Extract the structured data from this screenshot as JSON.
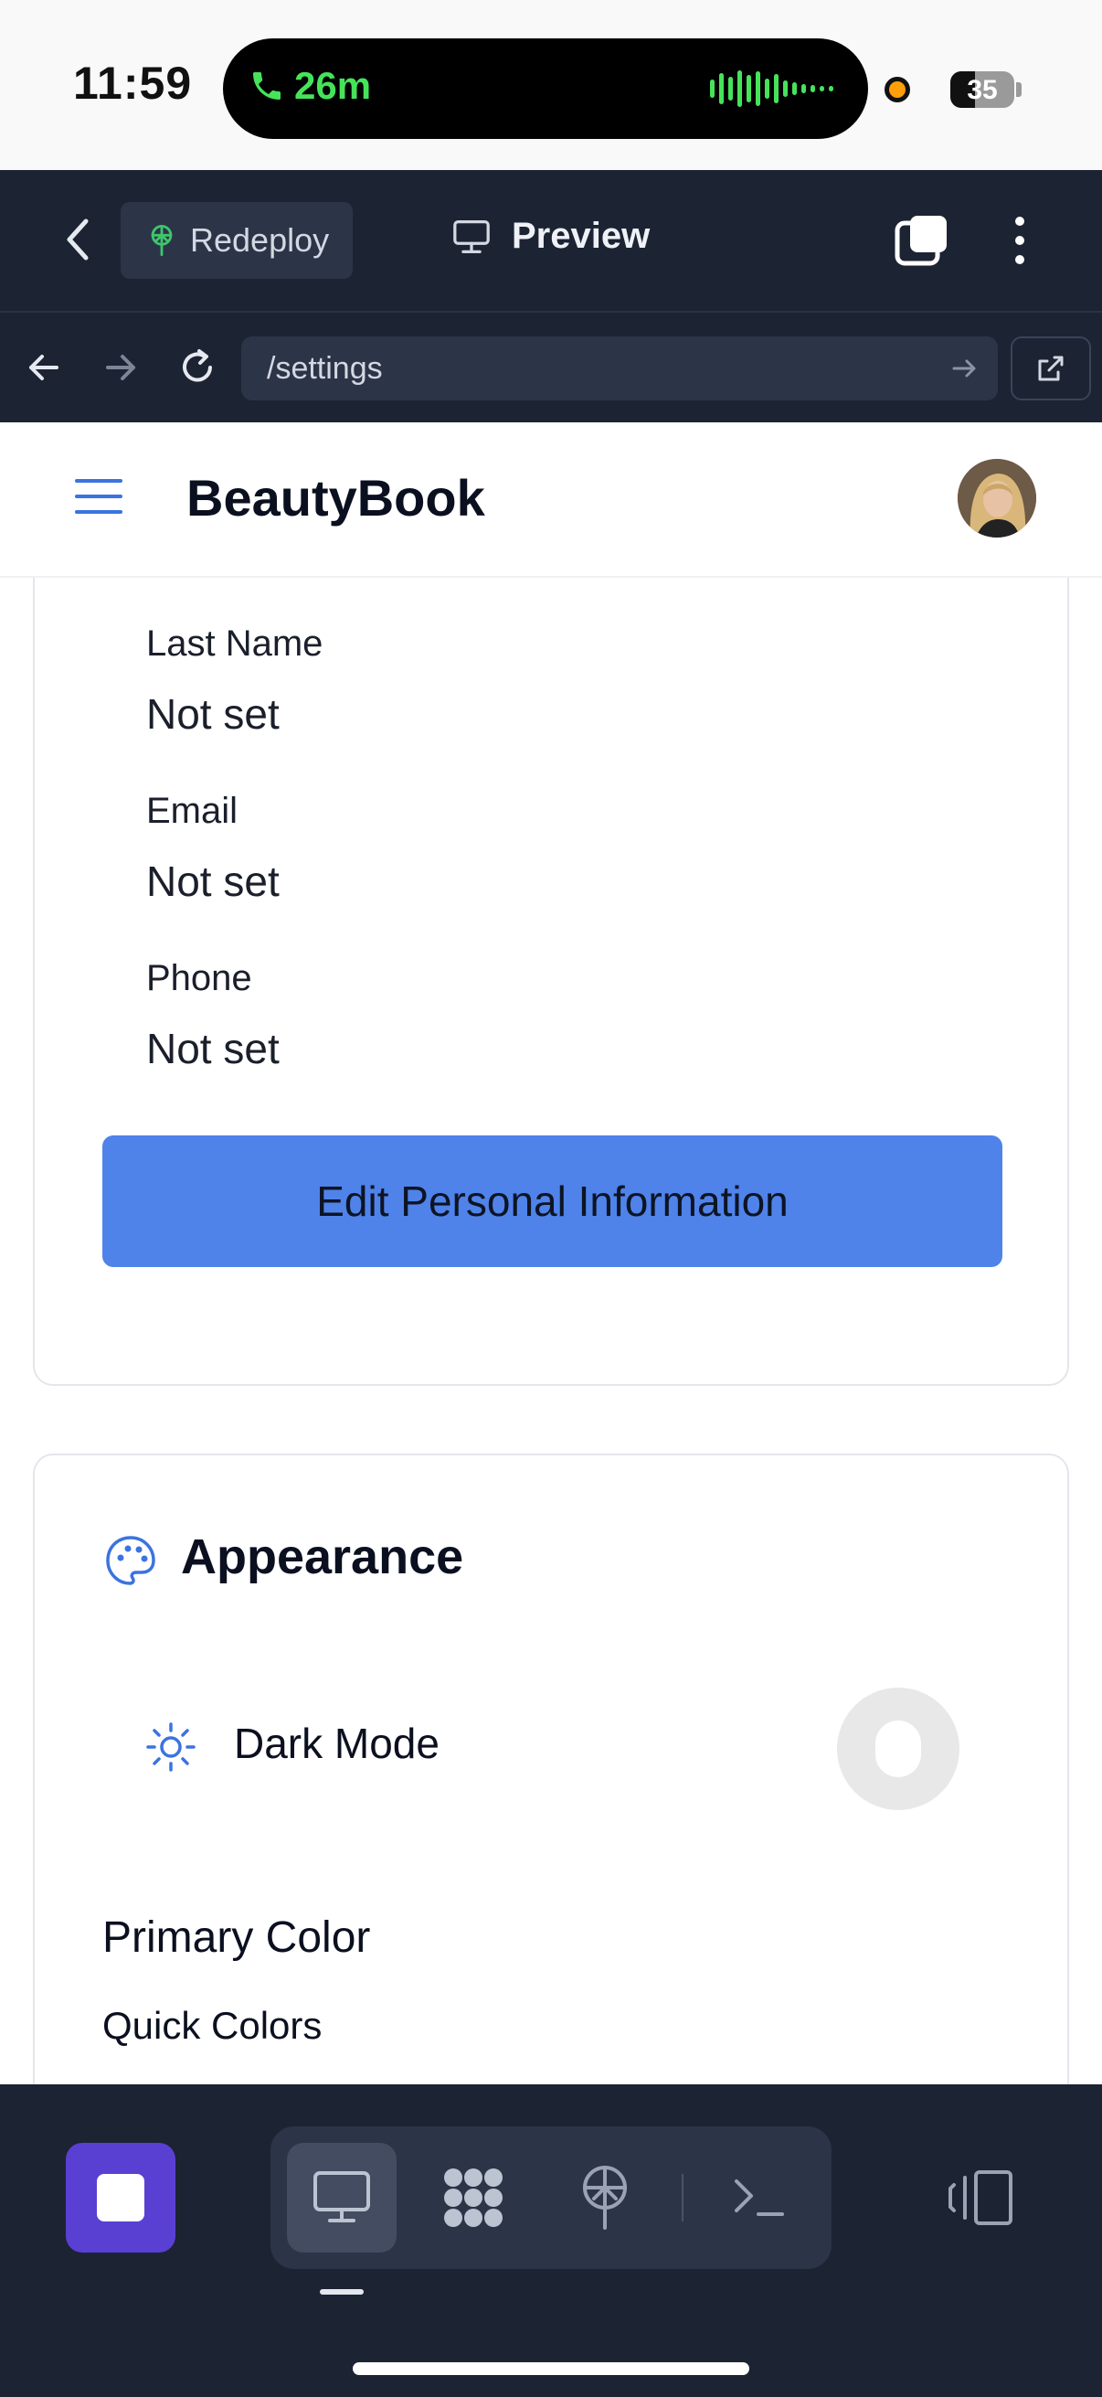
{
  "status_bar": {
    "time": "11:59",
    "call_duration": "26m",
    "battery": "35",
    "icons": [
      "phone-icon",
      "audio-wave-icon",
      "recording-dot-icon",
      "battery-icon"
    ]
  },
  "toolbar": {
    "redeploy_label": "Redeploy",
    "preview_label": "Preview",
    "icons": [
      "back-chevron-icon",
      "deploy-icon",
      "monitor-icon",
      "tabs-icon",
      "more-vertical-icon"
    ]
  },
  "urlbar": {
    "url": "/settings",
    "icons": [
      "arrow-left-icon",
      "arrow-right-icon",
      "reload-icon",
      "go-arrow-icon",
      "external-link-icon"
    ]
  },
  "app_header": {
    "brand": "BeautyBook",
    "icons": [
      "menu-icon",
      "avatar"
    ]
  },
  "personal_info": {
    "fields": [
      {
        "label": "Last Name",
        "value": "Not set"
      },
      {
        "label": "Email",
        "value": "Not set"
      },
      {
        "label": "Phone",
        "value": "Not set"
      }
    ],
    "edit_button": "Edit Personal Information"
  },
  "appearance": {
    "title": "Appearance",
    "dark_mode_label": "Dark Mode",
    "dark_mode_on": false,
    "primary_color_title": "Primary Color",
    "quick_colors_title": "Quick Colors",
    "icons": [
      "palette-icon",
      "sun-icon"
    ]
  },
  "bottom_bar": {
    "icons": [
      "stop-icon",
      "desktop-icon",
      "apps-grid-icon",
      "deploy-icon",
      "terminal-icon",
      "panel-toggle-icon"
    ],
    "active_tool": "desktop"
  },
  "colors": {
    "chrome_bg": "#1c2333",
    "chrome_control": "#2c3447",
    "accent_blue": "#4f83ea",
    "stop_purple": "#5a3fd3",
    "call_green": "#46e35a"
  }
}
